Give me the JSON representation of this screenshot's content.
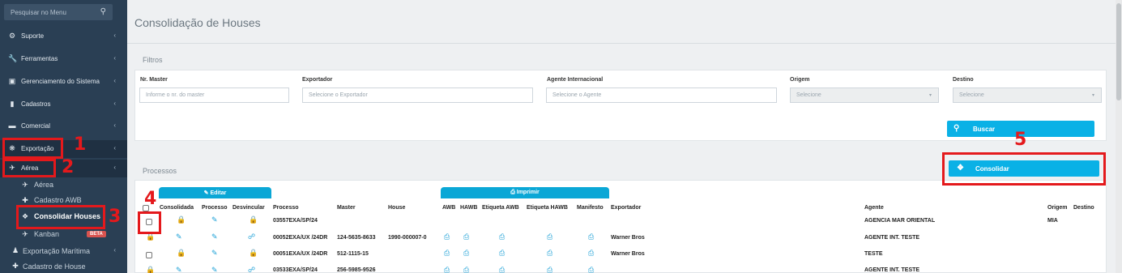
{
  "sidebar": {
    "search_placeholder": "Pesquisar no Menu",
    "items": [
      {
        "label": "Suporte",
        "icon": "cog-icon"
      },
      {
        "label": "Ferramentas",
        "icon": "wrench-icon"
      },
      {
        "label": "Gerenciamento do Sistema",
        "icon": "monitor-icon"
      },
      {
        "label": "Cadastros",
        "icon": "book-icon"
      },
      {
        "label": "Comercial",
        "icon": "briefcase-icon"
      },
      {
        "label": "Exportação",
        "icon": "globe-icon"
      },
      {
        "label": "Aérea",
        "icon": "plane-icon"
      }
    ],
    "sub_items": [
      {
        "label": "Aérea",
        "icon": "plane-icon"
      },
      {
        "label": "Cadastro AWB",
        "icon": "plus-icon"
      },
      {
        "label": "Consolidar Houses",
        "icon": "dropbox-icon"
      },
      {
        "label": "Kanban",
        "icon": "plane-icon",
        "badge": "BETA"
      },
      {
        "label": "Exportação Marítima",
        "icon": "person-icon"
      },
      {
        "label": "Cadastro de House",
        "icon": "plus-icon"
      }
    ]
  },
  "annotations": [
    "1",
    "2",
    "3",
    "4",
    "5"
  ],
  "page": {
    "title": "Consolidação de Houses",
    "filters_title": "Filtros",
    "processes_title": "Processos"
  },
  "filters": {
    "master_label": "Nr. Master",
    "master_placeholder": "Informe o nr. do master",
    "exportador_label": "Exportador",
    "exportador_placeholder": "Selecione o Exportador",
    "agente_label": "Agente Internacional",
    "agente_placeholder": "Selecione o Agente",
    "origem_label": "Origem",
    "origem_value": "Selecione",
    "destino_label": "Destino",
    "destino_value": "Selecione",
    "search_button": "Buscar"
  },
  "consolidar_button": "Consolidar",
  "tabs": {
    "editar": "Editar",
    "imprimir": "Imprimir"
  },
  "columns": [
    "Consolidada",
    "Processo",
    "Desvincular",
    "Processo",
    "Master",
    "House",
    "AWB",
    "HAWB",
    "Etiqueta AWB",
    "Etiqueta HAWB",
    "Manifesto",
    "Exportador",
    "Agente",
    "Origem",
    "Destino"
  ],
  "rows": [
    {
      "processo": "03557EXA/SP/24",
      "master": "",
      "house": "",
      "exportador": "",
      "agente": "AGENCIA MAR ORIENTAL",
      "origem": "MIA",
      "destino": ""
    },
    {
      "processo": "00052EXA/UX /24DR",
      "master": "124-5635-8633",
      "house": "1990-000007-0",
      "exportador": "Warner Bros",
      "agente": "AGENTE INT. TESTE",
      "origem": "",
      "destino": ""
    },
    {
      "processo": "00051EXA/UX /24DR",
      "master": "512-1115-15",
      "house": "",
      "exportador": "Warner Bros",
      "agente": "TESTE",
      "origem": "",
      "destino": ""
    },
    {
      "processo": "03533EXA/SP/24",
      "master": "256-5985-9526",
      "house": "",
      "exportador": "",
      "agente": "AGENTE INT. TESTE",
      "origem": "",
      "destino": ""
    }
  ]
}
